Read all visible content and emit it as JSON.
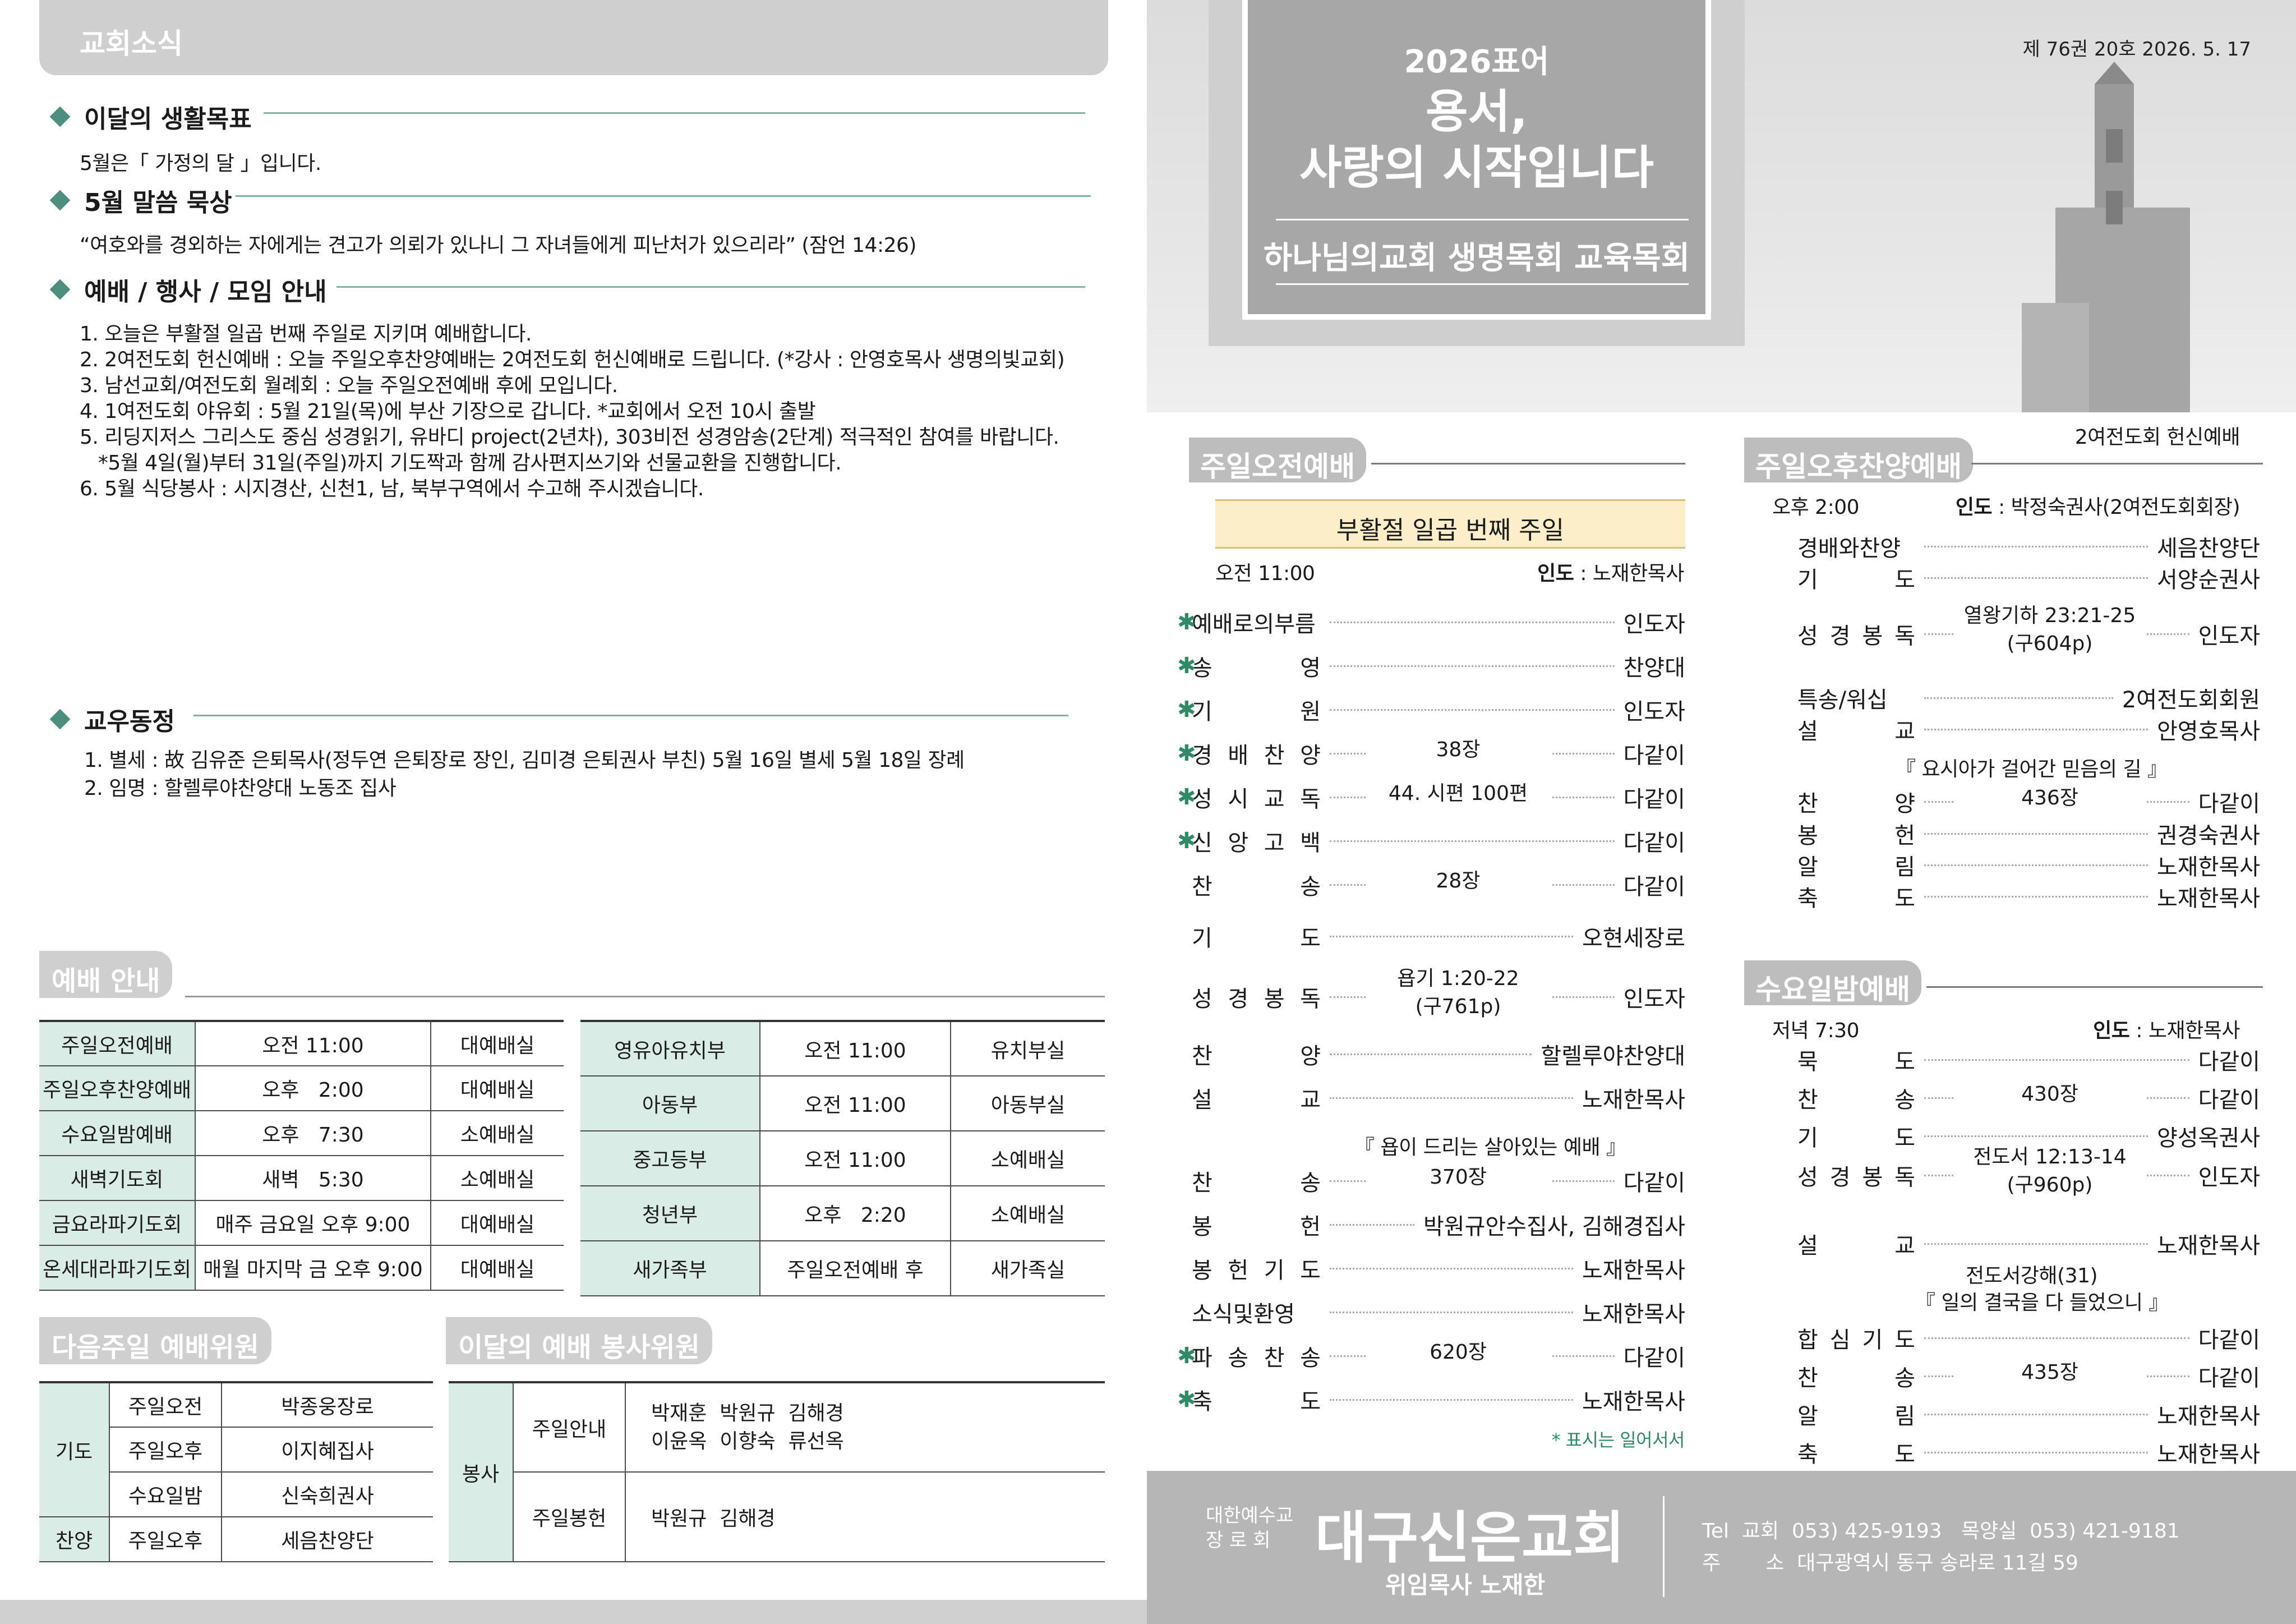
{
  "left": {
    "topbar_title": "교회소식",
    "goal": {
      "title": "이달의 생활목표",
      "text": "5월은「 가정의 달 」입니다."
    },
    "verse": {
      "title": "5월 말씀 묵상",
      "text": "“여호와를 경외하는 자에게는 견고가 의뢰가 있나니 그 자녀들에게 피난처가 있으리라” (잠언 14:26)"
    },
    "notices": {
      "title": "예배 / 행사 / 모임 안내",
      "items": [
        "1. 오늘은 부활절 일곱 번째 주일로 지키며 예배합니다.",
        "2. 2여전도회 헌신예배 : 오늘 주일오후찬양예배는 2여전도회 헌신예배로 드립니다. (*강사 : 안영호목사 생명의빛교회)",
        "3. 남선교회/여전도회 월례회 : 오늘 주일오전예배 후에 모입니다.",
        "4. 1여전도회 야유회 : 5월 21일(목)에 부산 기장으로 갑니다. *교회에서 오전 10시 출발",
        "5. 리딩지저스 그리스도 중심 성경읽기, 유바디 project(2년차), 303비전 성경암송(2단계) 적극적인 참여를 바랍니다.",
        "   *5월 4일(월)부터 31일(주일)까지 기도짝과 함께 감사편지쓰기와 선물교환을 진행합니다.",
        "6. 5월 식당봉사 : 시지경산, 신천1, 남, 북부구역에서 수고해 주시겠습니다."
      ]
    },
    "members": {
      "title": "교우동정",
      "items": [
        "1. 별세 : 故 김유준 은퇴목사(정두연 은퇴장로 장인, 김미경 은퇴권사 부친) 5월 16일 별세 5월 18일 장례",
        "2. 임명 : 할렐루야찬양대 노동조 집사"
      ]
    },
    "schedule": {
      "title": "예배 안내",
      "left_rows": [
        [
          "주일오전예배",
          "오전 11:00",
          "대예배실"
        ],
        [
          "주일오후찬양예배",
          "오후   2:00",
          "대예배실"
        ],
        [
          "수요일밤예배",
          "오후   7:30",
          "소예배실"
        ],
        [
          "새벽기도회",
          "새벽   5:30",
          "소예배실"
        ],
        [
          "금요라파기도회",
          "매주 금요일 오후 9:00",
          "대예배실"
        ],
        [
          "온세대라파기도회",
          "매월 마지막 금 오후 9:00",
          "대예배실"
        ]
      ],
      "right_rows": [
        [
          "영유아유치부",
          "오전 11:00",
          "유치부실"
        ],
        [
          "아동부",
          "오전 11:00",
          "아동부실"
        ],
        [
          "중고등부",
          "오전 11:00",
          "소예배실"
        ],
        [
          "청년부",
          "오후   2:20",
          "소예배실"
        ],
        [
          "새가족부",
          "주일오전예배 후",
          "새가족실"
        ]
      ]
    },
    "next_week": {
      "title": "다음주일 예배위원",
      "g1": "기도",
      "g2": "찬양",
      "rows": [
        [
          "주일오전",
          "박종웅장로"
        ],
        [
          "주일오후",
          "이지혜집사"
        ],
        [
          "수요일밤",
          "신숙희권사"
        ],
        [
          "주일오후",
          "세음찬양단"
        ]
      ]
    },
    "service": {
      "title": "이달의 예배 봉사위원",
      "group": "봉사",
      "r1_label": "주일안내",
      "r1_line1": "박재훈  박원규  김해경",
      "r1_line2": "이윤옥  이향숙  류선옥",
      "r2_label": "주일봉헌",
      "r2_val": "박원규  김해경"
    }
  },
  "right": {
    "hero": {
      "year": "2026표어",
      "motto1": "용서,",
      "motto2": "사랑의 시작입니다",
      "org": "하나님의교회 생명목회 교육목회"
    },
    "issue": "제 76권 20호  2026. 5. 17",
    "morning": {
      "title": "주일오전예배",
      "banner": "부활절 일곱 번째 주일",
      "time": "오전 11:00",
      "leader_label": "인도",
      "leader": " : 노재한목사",
      "items": [
        {
          "k": "예배로의부름",
          "mid": "",
          "v": "인도자",
          "star": true
        },
        {
          "k": "송영",
          "mid": "",
          "v": "찬양대",
          "star": true
        },
        {
          "k": "기원",
          "mid": "",
          "v": "인도자",
          "star": true
        },
        {
          "k": "경배찬양",
          "mid": "38장",
          "v": "다같이",
          "star": true
        },
        {
          "k": "성시교독",
          "mid": "44. 시편 100편",
          "v": "다같이",
          "star": true
        },
        {
          "k": "신앙고백",
          "mid": "",
          "v": "다같이",
          "star": true
        },
        {
          "k": "찬송",
          "mid": "28장",
          "v": "다같이",
          "star": false
        },
        {
          "k": "기도",
          "mid": "",
          "v": "오현세장로",
          "star": false
        },
        {
          "k": "성경봉독",
          "mid": "욥기 1:20-22\n(구761p)",
          "v": "인도자",
          "star": false
        },
        {
          "k": "찬양",
          "mid": "",
          "v": "할렐루야찬양대",
          "star": false
        },
        {
          "k": "설교",
          "mid": "",
          "v": "노재한목사",
          "star": false
        },
        {
          "k": "찬송",
          "mid": "370장",
          "v": "다같이",
          "star": false
        },
        {
          "k": "봉헌",
          "mid": "",
          "v": "박원규안수집사, 김해경집사",
          "star": false
        },
        {
          "k": "봉헌기도",
          "mid": "",
          "v": "노재한목사",
          "star": false
        },
        {
          "k": "소식및환영",
          "mid": "",
          "v": "노재한목사",
          "star": false
        },
        {
          "k": "파송찬송",
          "mid": "620장",
          "v": "다같이",
          "star": true
        },
        {
          "k": "축도",
          "mid": "",
          "v": "노재한목사",
          "star": true
        }
      ],
      "sermon_title": "『 욥이 드리는 살아있는 예배 』",
      "star_note": "* 표시는 일어서서"
    },
    "afternoon": {
      "title": "주일오후찬양예배",
      "subtitle": "2여전도회 헌신예배",
      "time": "오후 2:00",
      "leader_label": "인도",
      "leader": " : 박정숙권사(2여전도회회장)",
      "items": [
        {
          "k": "경배와찬양",
          "mid": "",
          "v": "세음찬양단"
        },
        {
          "k": "기도",
          "mid": "",
          "v": "서양순권사"
        },
        {
          "k": "성경봉독",
          "mid": "열왕기하 23:21-25\n(구604p)",
          "v": "인도자"
        },
        {
          "k": "특송/워십",
          "mid": "",
          "v": "2여전도회회원"
        },
        {
          "k": "설교",
          "mid": "",
          "v": "안영호목사"
        },
        {
          "k": "찬양",
          "mid": "436장",
          "v": "다같이"
        },
        {
          "k": "봉헌",
          "mid": "",
          "v": "권경숙권사"
        },
        {
          "k": "알림",
          "mid": "",
          "v": "노재한목사"
        },
        {
          "k": "축도",
          "mid": "",
          "v": "노재한목사"
        }
      ],
      "sermon_title": "『 요시아가 걸어간 믿음의 길 』"
    },
    "wednesday": {
      "title": "수요일밤예배",
      "time": "저녁 7:30",
      "leader_label": "인도",
      "leader": " : 노재한목사",
      "items": [
        {
          "k": "묵도",
          "mid": "",
          "v": "다같이"
        },
        {
          "k": "찬송",
          "mid": "430장",
          "v": "다같이"
        },
        {
          "k": "기도",
          "mid": "",
          "v": "양성옥권사"
        },
        {
          "k": "성경봉독",
          "mid": "전도서 12:13-14\n(구960p)",
          "v": "인도자"
        },
        {
          "k": "설교",
          "mid": "",
          "v": "노재한목사"
        },
        {
          "k": "합심기도",
          "mid": "",
          "v": "다같이"
        },
        {
          "k": "찬송",
          "mid": "435장",
          "v": "다같이"
        },
        {
          "k": "알림",
          "mid": "",
          "v": "노재한목사"
        },
        {
          "k": "축도",
          "mid": "",
          "v": "노재한목사"
        }
      ],
      "series": "전도서강해(31)",
      "sermon_title": "『 일의 결국을 다 들었으니 』"
    },
    "footer": {
      "denom1": "대한예수교",
      "denom2": "장 로 회",
      "church": "대구신은교회",
      "pastor": "위임목사 노재한",
      "tel": "Tel  교회  053) 425-9193   목양실  053) 421-9181",
      "addr": "주       소  대구광역시 동구 송라로 11길 59"
    }
  }
}
